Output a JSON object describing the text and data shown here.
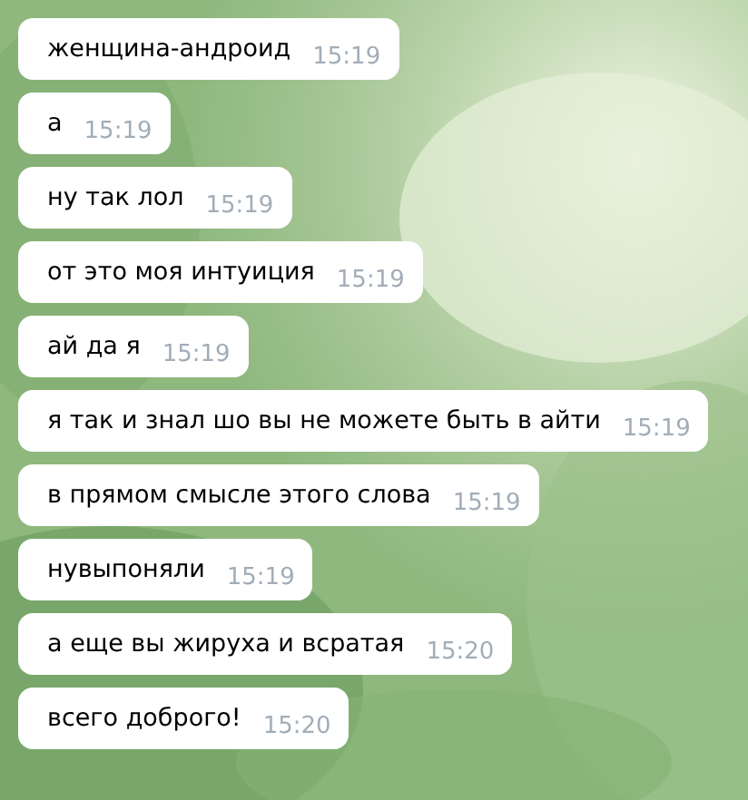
{
  "messages": [
    {
      "text": "женщина-андроид",
      "time": "15:19"
    },
    {
      "text": "а",
      "time": "15:19"
    },
    {
      "text": "ну так лол",
      "time": "15:19"
    },
    {
      "text": "от это моя интуиция",
      "time": "15:19"
    },
    {
      "text": "ай да я",
      "time": "15:19"
    },
    {
      "text": "я так и знал шо вы не можете быть в айти",
      "time": "15:19"
    },
    {
      "text": "в прямом смысле этого слова",
      "time": "15:19"
    },
    {
      "text": "нувыпоняли",
      "time": "15:19"
    },
    {
      "text": "а еще вы жируха и всратая",
      "time": "15:20"
    },
    {
      "text": "всего доброго!",
      "time": "15:20"
    }
  ]
}
